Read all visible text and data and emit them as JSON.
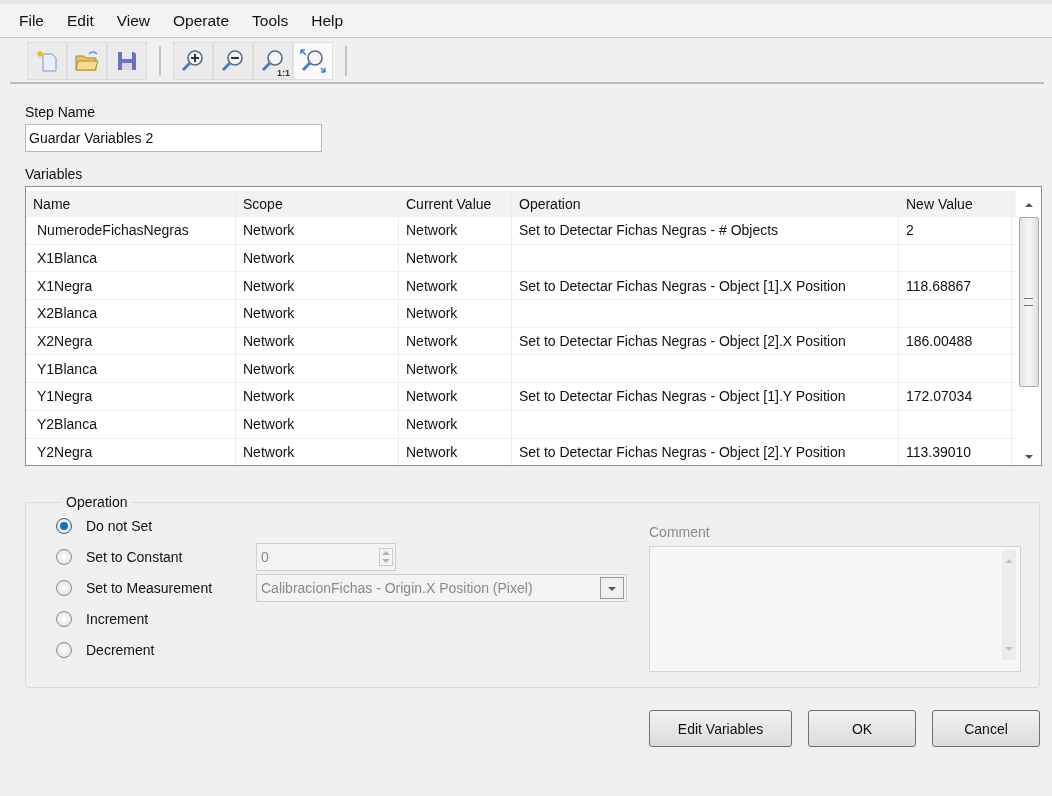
{
  "menu": [
    "File",
    "Edit",
    "View",
    "Operate",
    "Tools",
    "Help"
  ],
  "toolbar": [
    {
      "kind": "new",
      "pressed": false
    },
    {
      "kind": "open",
      "pressed": false
    },
    {
      "kind": "save",
      "pressed": false
    },
    {
      "kind": "separator"
    },
    {
      "kind": "zoom_in",
      "pressed": false
    },
    {
      "kind": "zoom_out",
      "pressed": false
    },
    {
      "kind": "zoom_actual",
      "label": "1:1",
      "pressed": false
    },
    {
      "kind": "zoom_fit",
      "pressed": true
    },
    {
      "kind": "separator"
    }
  ],
  "step_name": {
    "label": "Step Name",
    "value": "Guardar Variables 2"
  },
  "variables": {
    "label": "Variables",
    "columns": [
      "Name",
      "Scope",
      "Current Value",
      "Operation",
      "New Value"
    ],
    "rows": [
      [
        "NumerodeFichasNegras",
        "Network",
        "Network",
        "Set to Detectar Fichas Negras - # Objects",
        "2"
      ],
      [
        "X1Blanca",
        "Network",
        "Network",
        "",
        ""
      ],
      [
        "X1Negra",
        "Network",
        "Network",
        "Set to Detectar Fichas Negras - Object [1].X Position",
        "118.68867"
      ],
      [
        "X2Blanca",
        "Network",
        "Network",
        "",
        ""
      ],
      [
        "X2Negra",
        "Network",
        "Network",
        "Set to Detectar Fichas Negras - Object [2].X Position",
        "186.00488"
      ],
      [
        "Y1Blanca",
        "Network",
        "Network",
        "",
        ""
      ],
      [
        "Y1Negra",
        "Network",
        "Network",
        "Set to Detectar Fichas Negras - Object [1].Y Position",
        "172.07034"
      ],
      [
        "Y2Blanca",
        "Network",
        "Network",
        "",
        ""
      ],
      [
        "Y2Negra",
        "Network",
        "Network",
        "Set to Detectar Fichas Negras - Object [2].Y Position",
        "113.39010"
      ]
    ]
  },
  "operation": {
    "title": "Operation",
    "options": [
      {
        "kind": "plain",
        "label": "Do not Set",
        "selected": true
      },
      {
        "kind": "spinbox",
        "label": "Set to Constant",
        "selected": false,
        "field": {
          "value": "0",
          "disabled": true
        }
      },
      {
        "kind": "dropdown",
        "label": "Set to Measurement",
        "selected": false,
        "field": {
          "value": "CalibracionFichas - Origin.X Position (Pixel)",
          "disabled": true
        }
      },
      {
        "kind": "plain",
        "label": "Increment",
        "selected": false
      },
      {
        "kind": "plain",
        "label": "Decrement",
        "selected": false
      }
    ],
    "comment": {
      "label": "Comment",
      "disabled": true
    }
  },
  "buttons": [
    "Edit Variables",
    "OK",
    "Cancel"
  ]
}
